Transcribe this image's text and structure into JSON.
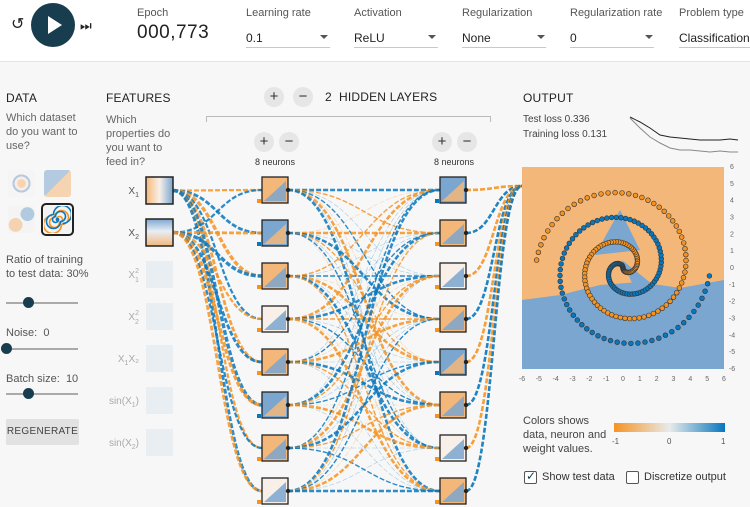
{
  "controls": {
    "reset_icon": "reset-icon",
    "play_icon": "play-icon",
    "step_icon": "step-icon",
    "reset_glyph": "↺",
    "step_glyph": "⏭"
  },
  "epoch": {
    "label": "Epoch",
    "value": "000,773"
  },
  "params": [
    {
      "label": "Learning rate",
      "value": "0.1"
    },
    {
      "label": "Activation",
      "value": "ReLU"
    },
    {
      "label": "Regularization",
      "value": "None"
    },
    {
      "label": "Regularization rate",
      "value": "0"
    },
    {
      "label": "Problem type",
      "value": "Classification"
    }
  ],
  "data_panel": {
    "title": "DATA",
    "question": "Which dataset do you want to use?",
    "ratio_label": "Ratio of training to test data:",
    "ratio_value": "30%",
    "ratio_fraction": 0.3,
    "noise_label": "Noise:",
    "noise_value": "0",
    "noise_fraction": 0,
    "batch_label": "Batch size:",
    "batch_value": "10",
    "batch_fraction": 0.31,
    "regenerate": "REGENERATE"
  },
  "features": {
    "title": "FEATURES",
    "question": "Which properties do you want to feed in?",
    "items": [
      {
        "label": "X",
        "sub": "1",
        "sup": "",
        "active": true
      },
      {
        "label": "X",
        "sub": "2",
        "sup": "",
        "active": true
      },
      {
        "label": "X",
        "sub": "1",
        "sup": "2",
        "active": false
      },
      {
        "label": "X",
        "sub": "2",
        "sup": "2",
        "active": false
      },
      {
        "label": "X",
        "sub": "1",
        "sup": "",
        "extra": "X₂",
        "active": false
      },
      {
        "label": "sin(X",
        "sub": "1",
        "sup": "",
        "active": false
      },
      {
        "label": "sin(X",
        "sub": "2",
        "sup": "",
        "active": false
      }
    ]
  },
  "hidden": {
    "count": "2",
    "title": "HIDDEN LAYERS",
    "layer1_neurons": "8 neurons",
    "layer2_neurons": "8 neurons",
    "plus": "+",
    "minus": "−"
  },
  "output": {
    "title": "OUTPUT",
    "test_loss": "Test loss 0.336",
    "training_loss": "Training loss 0.131",
    "axis_ticks": [
      "-6",
      "-5",
      "-4",
      "-3",
      "-2",
      "-1",
      "0",
      "1",
      "2",
      "3",
      "4",
      "5",
      "6"
    ],
    "legend_text": "Colors shows data, neuron and weight values.",
    "legend_ticks": [
      "-1",
      "0",
      "1"
    ],
    "show_test": "Show test data",
    "discretize": "Discretize output",
    "colors": {
      "orange": "#f59322",
      "blue": "#0877bd",
      "light_orange": "#f4b77a",
      "light_blue": "#7ba6cf"
    }
  }
}
